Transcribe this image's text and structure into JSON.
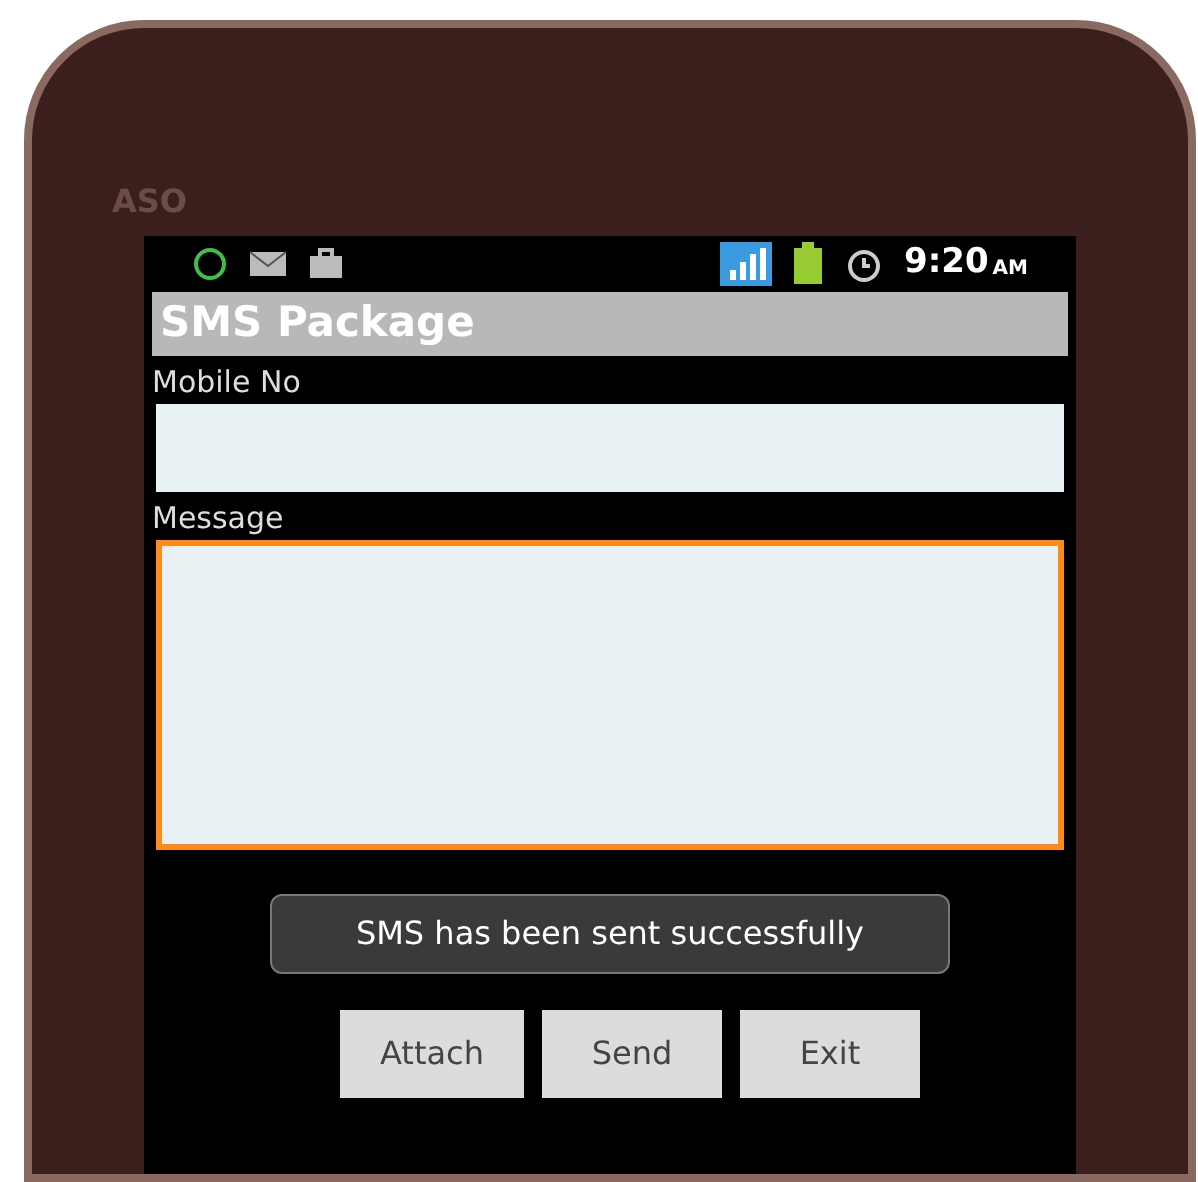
{
  "device": {
    "brand": "ASO"
  },
  "status_bar": {
    "time": "9:20",
    "ampm": "AM"
  },
  "app_title": "SMS Package",
  "fields": [
    {
      "label": "Mobile No",
      "kind": "input",
      "focused": false
    },
    {
      "label": "Message",
      "kind": "textarea",
      "focused": true
    }
  ],
  "toast": "SMS has been sent successfully",
  "buttons": [
    "Attach",
    "Send",
    "Exit"
  ]
}
